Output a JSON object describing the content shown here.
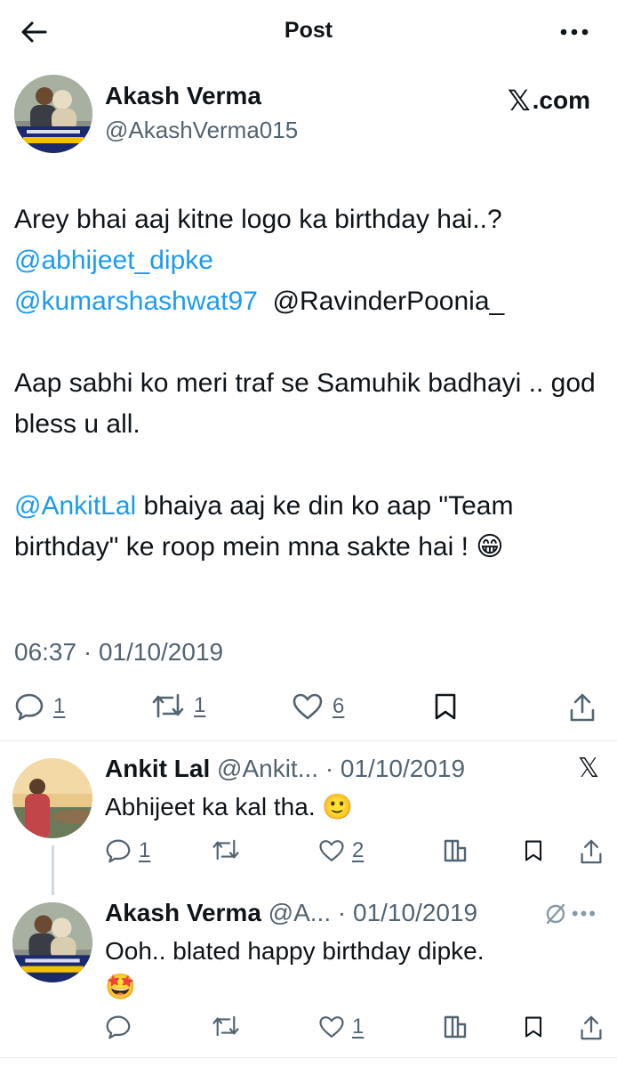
{
  "header": {
    "title": "Post"
  },
  "main_post": {
    "author_name": "Akash Verma",
    "author_handle": "@AkashVerma015",
    "source_label": ".com",
    "lines": {
      "p1_text": "Arey bhai aaj kitne logo ka birthday hai..? ",
      "p1_mention1": "@abhijeet_dipke",
      "p1_mention2": "@kumarshashwat97",
      "p1_mention3": "@RavinderPoonia_",
      "p2_text": "Aap sabhi ko meri traf se Samuhik badhayi .. god bless u all.",
      "p3_mention": "@AnkitLal",
      "p3_text": " bhaiya aaj ke din ko aap \"Team birthday\" ke roop mein mna sakte hai ! ",
      "p3_emoji": "😁"
    },
    "timestamp": "06:37 · 01/10/2019",
    "stats": {
      "replies": "1",
      "reposts": "1",
      "likes": "6"
    }
  },
  "replies": [
    {
      "author_name": "Ankit Lal",
      "author_handle": "@Ankit...",
      "date": "· 01/10/2019",
      "text": "Abhijeet ka kal tha. ",
      "emoji": "🙂",
      "stats": {
        "replies": "1",
        "likes": "2"
      }
    },
    {
      "author_name": "Akash Verma",
      "author_handle": "@A...",
      "date": "· 01/10/2019",
      "text": "Ooh.. blated happy birthday dipke.",
      "emoji": "🤩",
      "stats": {
        "likes": "1"
      }
    }
  ],
  "icons": {
    "back": "arrow-left-icon",
    "more": "more-horizontal-icon",
    "reply": "comment-icon",
    "repost": "repost-icon",
    "like": "heart-icon",
    "bookmark": "bookmark-icon",
    "share": "share-icon",
    "views": "bar-chart-icon",
    "x_logo": "x-logo-icon"
  },
  "colors": {
    "mention": "#1d9bf0",
    "muted": "#536471",
    "text": "#0f1419"
  }
}
